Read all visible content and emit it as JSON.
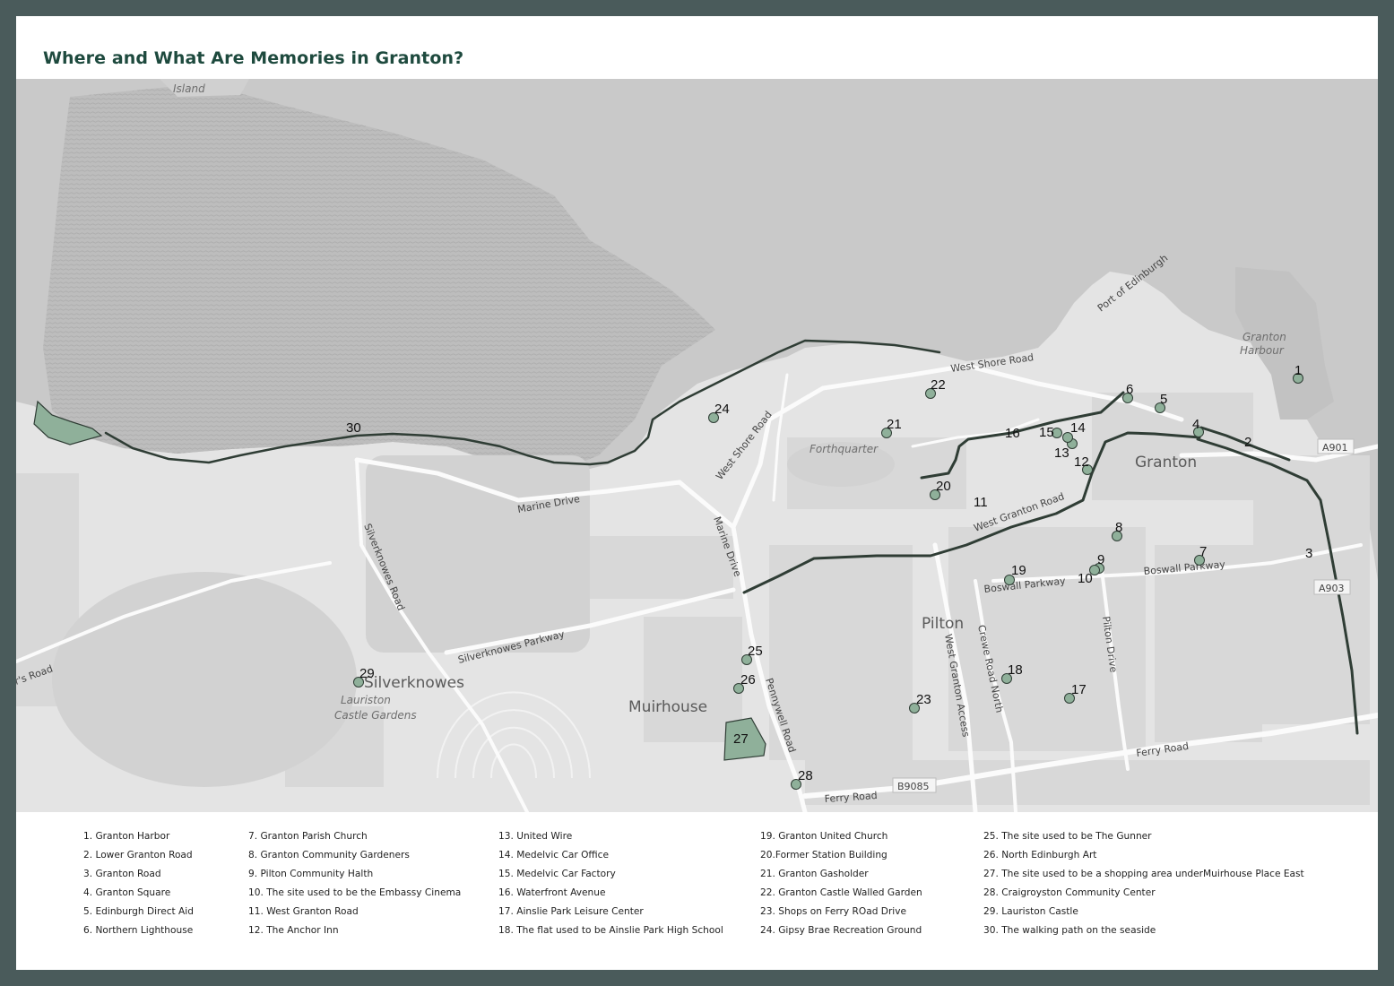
{
  "title": "Where and What Are Memories in Granton?",
  "colors": {
    "frame": "#4a5b5b",
    "title": "#1e4a3e",
    "marker_fill": "#8fb09a",
    "marker_stroke": "#2f3d35",
    "route_line": "#2f3d35",
    "sea": "#c7c7c7",
    "land": "#e3e3e3"
  },
  "map": {
    "place_labels": [
      {
        "id": "granton",
        "text": "Granton"
      },
      {
        "id": "pilton",
        "text": "Pilton"
      },
      {
        "id": "muirhouse",
        "text": "Muirhouse"
      },
      {
        "id": "silverknowes",
        "text": "Silverknowes"
      }
    ],
    "italic_labels": [
      {
        "id": "island",
        "text": "Island"
      },
      {
        "id": "forthquarter",
        "text": "Forthquarter"
      },
      {
        "id": "lauriston1",
        "text": "Lauriston"
      },
      {
        "id": "lauriston2",
        "text": "Castle Gardens"
      },
      {
        "id": "harbour1",
        "text": "Granton"
      },
      {
        "id": "harbour2",
        "text": "Harbour"
      }
    ],
    "street_labels": [
      {
        "id": "west-shore-road-1",
        "text": "West Shore Road"
      },
      {
        "id": "west-shore-road-2",
        "text": "West Shore Road"
      },
      {
        "id": "marine-drive-1",
        "text": "Marine Drive"
      },
      {
        "id": "marine-drive-2",
        "text": "Marine Drive"
      },
      {
        "id": "silverknowes-road",
        "text": "Silverknowes Road"
      },
      {
        "id": "silverknowes-parkway",
        "text": "Silverknowes Parkway"
      },
      {
        "id": "boswall-parkway-1",
        "text": "Boswall Parkway"
      },
      {
        "id": "boswall-parkway-2",
        "text": "Boswall Parkway"
      },
      {
        "id": "pennywell-road",
        "text": "Pennywell Road"
      },
      {
        "id": "west-granton-access",
        "text": "West Granton Access"
      },
      {
        "id": "crewe-road-north",
        "text": "Crewe Road North"
      },
      {
        "id": "pilton-drive",
        "text": "Pilton Drive"
      },
      {
        "id": "ferry-road-1",
        "text": "Ferry Road"
      },
      {
        "id": "ferry-road-2",
        "text": "Ferry Road"
      },
      {
        "id": "west-granton-road",
        "text": "West Granton Road"
      },
      {
        "id": "port-of-edinburgh",
        "text": "Port of Edinburgh"
      },
      {
        "id": "lauriston-road",
        "text": "r's Road"
      }
    ],
    "road_shields": [
      {
        "id": "a901",
        "text": "A901"
      },
      {
        "id": "a903",
        "text": "A903"
      },
      {
        "id": "b9085",
        "text": "B9085"
      }
    ],
    "markers": [
      {
        "id": "m1",
        "label": "1"
      },
      {
        "id": "m2",
        "label": "2"
      },
      {
        "id": "m3",
        "label": "3"
      },
      {
        "id": "m4",
        "label": "4"
      },
      {
        "id": "m5",
        "label": "5"
      },
      {
        "id": "m6",
        "label": "6"
      },
      {
        "id": "m7",
        "label": "7"
      },
      {
        "id": "m8",
        "label": "8"
      },
      {
        "id": "m9",
        "label": "9"
      },
      {
        "id": "m10",
        "label": "10"
      },
      {
        "id": "m11",
        "label": "11"
      },
      {
        "id": "m12",
        "label": "12"
      },
      {
        "id": "m13",
        "label": "13"
      },
      {
        "id": "m14",
        "label": "14"
      },
      {
        "id": "m15",
        "label": "15"
      },
      {
        "id": "m16",
        "label": "16"
      },
      {
        "id": "m17",
        "label": "17"
      },
      {
        "id": "m18",
        "label": "18"
      },
      {
        "id": "m19",
        "label": "19"
      },
      {
        "id": "m20",
        "label": "20"
      },
      {
        "id": "m21",
        "label": "21"
      },
      {
        "id": "m22",
        "label": "22"
      },
      {
        "id": "m23",
        "label": "23"
      },
      {
        "id": "m24",
        "label": "24"
      },
      {
        "id": "m25",
        "label": "25"
      },
      {
        "id": "m26",
        "label": "26"
      },
      {
        "id": "m27",
        "label": "27"
      },
      {
        "id": "m28",
        "label": "28"
      },
      {
        "id": "m29",
        "label": "29"
      },
      {
        "id": "m30",
        "label": "30"
      }
    ]
  },
  "legend": {
    "columns": [
      [
        "1. Granton Harbor",
        "2. Lower Granton Road",
        "3. Granton Road",
        "4. Granton Square",
        "5. Edinburgh Direct Aid",
        "6. Northern Lighthouse"
      ],
      [
        "7. Granton Parish Church",
        "8. Granton Community Gardeners",
        "9. Pilton Community Halth",
        "10. The site used to be the Embassy Cinema",
        "11. West Granton Road",
        "12. The Anchor Inn"
      ],
      [
        "13. United Wire",
        "14. Medelvic Car Office",
        "15. Medelvic Car Factory",
        "16. Waterfront Avenue",
        "17. Ainslie Park Leisure Center",
        "18. The flat used to be Ainslie Park High School"
      ],
      [
        "19. Granton United Church",
        "20.Former Station Building",
        "21. Granton Gasholder",
        "22. Granton Castle Walled Garden",
        "23. Shops on Ferry ROad Drive",
        "24. Gipsy Brae Recreation Ground"
      ],
      [
        "25. The site used to be The Gunner",
        "26. North Edinburgh Art",
        "27. The site used to be a shopping area underMuirhouse Place East",
        "28. Craigroyston Community Center",
        "29. Lauriston Castle",
        "30. The walking path on the seaside"
      ]
    ]
  }
}
